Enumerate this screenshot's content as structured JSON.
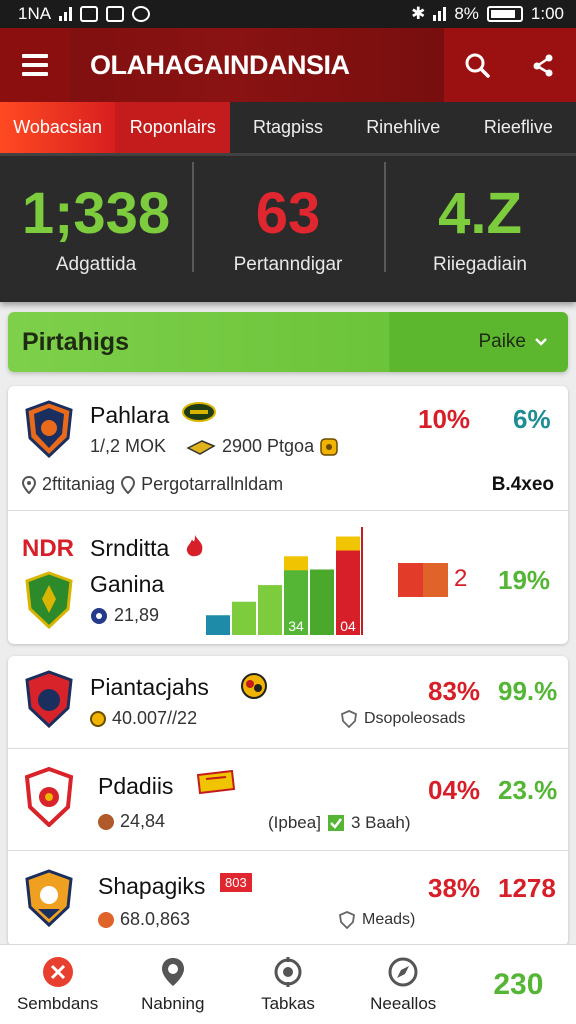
{
  "status_bar": {
    "carrier": "1NA",
    "battery_pct": "8%",
    "time": "1:00"
  },
  "app_bar": {
    "title": "OLAHAGAINDANSIA"
  },
  "tabs": [
    {
      "label": "Wobacsian"
    },
    {
      "label": "Roponlairs"
    },
    {
      "label": "Rtagpiss"
    },
    {
      "label": "Rinehlive"
    },
    {
      "label": "Rieeflive"
    }
  ],
  "stats": [
    {
      "value": "1;338",
      "label": "Adgattida",
      "color": "#7ccc3d"
    },
    {
      "value": "63",
      "label": "Pertanndigar",
      "color": "#e0262e"
    },
    {
      "value": "4.Z",
      "label": "Riiegadiain",
      "color": "#7ccc3d"
    }
  ],
  "section": {
    "title": "Pirtahigs",
    "filter": "Paike"
  },
  "card1": {
    "name": "Pahlara",
    "sub1": "1/,2 MOK",
    "sub2": "2900 Ptgoa",
    "pct1": "10%",
    "pct2": "6%",
    "footer_left": "2ftitaniag",
    "footer_mid": "Pergotarrallnldam",
    "footer_right": "B.4xeo"
  },
  "card2": {
    "prefix": "NDR",
    "name": "Srnditta",
    "team2": "Ganina",
    "sub": "21,89",
    "bar_labels": [
      "34",
      "04"
    ],
    "bar_values": [
      0.19,
      0.32,
      0.48,
      0.68,
      0.63,
      0.87
    ],
    "pct_label": "2",
    "pct": "19%"
  },
  "list": [
    {
      "name": "Piantacjahs",
      "sub": "40.007//22",
      "tag": "Dsopoleosads",
      "pct1": "83%",
      "pct2": "99.%"
    },
    {
      "name": "Pdadiis",
      "sub": "24,84",
      "tag_a": "(Ipbea]",
      "tag_b": "3 Baah)",
      "pct1": "04%",
      "pct2": "23.%"
    },
    {
      "name": "Shapagiks",
      "badge": "803",
      "sub": "68.0,863",
      "tag": "Meads)",
      "pct1": "38%",
      "pct2": "1278"
    }
  ],
  "bottom_nav": [
    {
      "label": "Sembdans",
      "icon": "close-icon"
    },
    {
      "label": "Nabning",
      "icon": "location-pin-icon"
    },
    {
      "label": "Tabkas",
      "icon": "target-icon"
    },
    {
      "label": "Neeallos",
      "icon": "compass-icon"
    }
  ],
  "bottom_value": "230",
  "colors": {
    "primary_red": "#8a1212",
    "accent_orange": "#ff4a22",
    "green": "#55b535"
  }
}
